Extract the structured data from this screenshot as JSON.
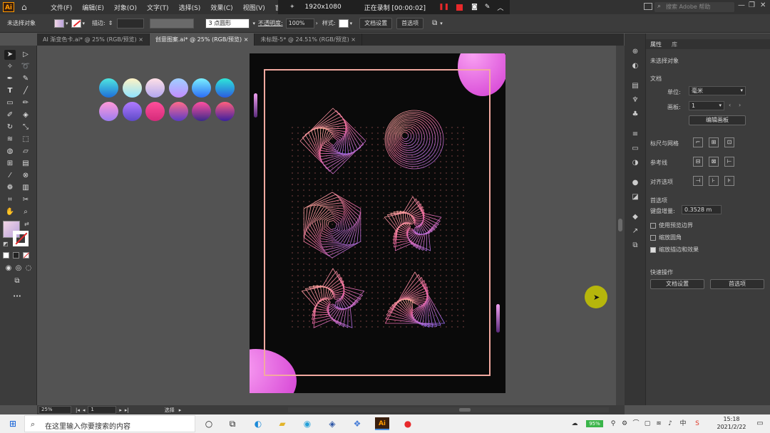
{
  "menubar": {
    "logo": "Ai",
    "items": [
      "文件(F)",
      "编辑(E)",
      "对象(O)",
      "文字(T)",
      "选择(S)",
      "效果(C)",
      "视图(V)",
      "窗口(W)"
    ],
    "search_placeholder": "搜索 Adobe 帮助"
  },
  "recorder": {
    "resolution": "1920x1080",
    "status": "正在录制 [00:00:02]"
  },
  "control_bar": {
    "selection_label": "未选择对象",
    "stroke_label": "描边:",
    "brush_value": "3 点圆形",
    "opacity_label": "不透明度:",
    "opacity_value": "100%",
    "style_label": "样式:",
    "doc_setup_btn": "文档设置",
    "prefs_btn": "首选项"
  },
  "tabs": [
    {
      "label": "AI 渐变色卡.ai* @ 25% (RGB/预览)",
      "active": false
    },
    {
      "label": "创意图案.ai* @ 25% (RGB/预览)",
      "active": true
    },
    {
      "label": "未标题-5* @ 24.51% (RGB/预览)",
      "active": false
    }
  ],
  "gradient_swatches": {
    "row1": [
      [
        "#4fe6e0",
        "#1e6fd9"
      ],
      [
        "#fff3c4",
        "#8fe3ff"
      ],
      [
        "#ffe0e6",
        "#b2a6f0"
      ],
      [
        "#9fd0ff",
        "#c28cff"
      ],
      [
        "#7af0ff",
        "#2c6df5"
      ],
      [
        "#2ee6d8",
        "#2b5ce0"
      ]
    ],
    "row2": [
      [
        "#ff9ad8",
        "#9b7cf0"
      ],
      [
        "#b07bff",
        "#5d4ac8"
      ],
      [
        "#ff4f9a",
        "#d42a7a"
      ],
      [
        "#ff6b8b",
        "#5b3cc4"
      ],
      [
        "#ff4fa0",
        "#3a2a8a"
      ],
      [
        "#ff5f7e",
        "#3b1fa0"
      ]
    ]
  },
  "properties_panel": {
    "tab_properties": "属性",
    "tab_library": "库",
    "no_selection": "未选择对象",
    "section_document": "文档",
    "unit_label": "单位:",
    "unit_value": "毫米",
    "artboard_label": "画板:",
    "artboard_value": "1",
    "edit_artboards_btn": "编辑画板",
    "rulers_grids": "标尺与网格",
    "guides": "参考线",
    "align_options": "对齐选项",
    "preferences": "首选项",
    "keyboard_increment_label": "键盘增量:",
    "keyboard_increment_value": "0.3528 m",
    "use_preview_bounds": "使用预览边界",
    "use_preview_bounds_checked": false,
    "scale_corners": "缩放圆角",
    "scale_corners_checked": false,
    "scale_strokes_effects": "缩放描边和效果",
    "scale_strokes_effects_checked": true,
    "quick_actions": "快速操作",
    "quick_doc_setup": "文档设置",
    "quick_prefs": "首选项"
  },
  "statusbar": {
    "zoom": "25%",
    "artboard": "1",
    "tool": "选择"
  },
  "taskbar": {
    "search_placeholder": "在这里输入你要搜索的内容",
    "battery": "95%",
    "time": "15:18",
    "date": "2021/2/22"
  },
  "colors": {
    "accent_pink": "#e24bd6",
    "frame_stroke": "#f2a9a0",
    "record_red": "#e8292b"
  }
}
